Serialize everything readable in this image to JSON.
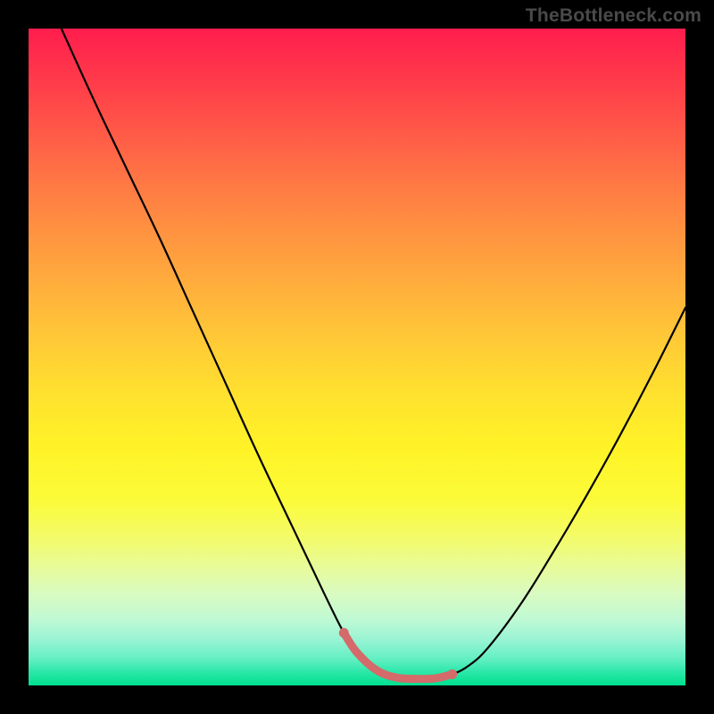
{
  "watermark": "TheBottleneck.com",
  "colors": {
    "frame": "#000000",
    "curve_stroke": "#000000",
    "highlight_stroke": "#d46a6a",
    "gradient_top": "#ff1d4d",
    "gradient_bottom": "#00e08f"
  },
  "chart_data": {
    "type": "line",
    "title": "",
    "xlabel": "",
    "ylabel": "",
    "xlim": [
      0,
      100
    ],
    "ylim": [
      0,
      100
    ],
    "series": [
      {
        "name": "black-curve",
        "x": [
          5,
          10,
          15,
          20,
          25,
          30,
          35,
          40,
          45,
          48,
          50,
          53,
          56,
          59,
          62,
          64.5,
          67,
          70,
          75,
          80,
          85,
          90,
          95,
          100
        ],
        "values": [
          100,
          89,
          78.5,
          68,
          57,
          46,
          35,
          24.5,
          14,
          8,
          5,
          2.3,
          1.2,
          1,
          1.1,
          1.7,
          3,
          5.8,
          12.5,
          20.5,
          29,
          38,
          47.5,
          57.5
        ]
      },
      {
        "name": "bottom-highlight",
        "x": [
          48,
          50,
          53,
          56,
          59,
          62,
          64.5
        ],
        "values": [
          8,
          5,
          2.3,
          1.2,
          1,
          1.1,
          1.7
        ]
      }
    ]
  }
}
